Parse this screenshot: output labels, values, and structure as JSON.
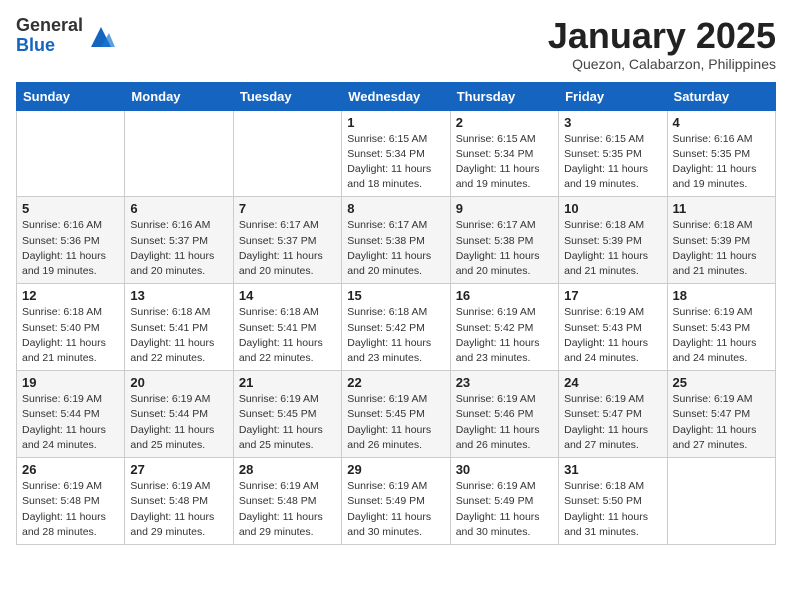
{
  "header": {
    "logo_general": "General",
    "logo_blue": "Blue",
    "month_title": "January 2025",
    "location": "Quezon, Calabarzon, Philippines"
  },
  "days_of_week": [
    "Sunday",
    "Monday",
    "Tuesday",
    "Wednesday",
    "Thursday",
    "Friday",
    "Saturday"
  ],
  "weeks": [
    [
      {
        "day": "",
        "sunrise": "",
        "sunset": "",
        "daylight": ""
      },
      {
        "day": "",
        "sunrise": "",
        "sunset": "",
        "daylight": ""
      },
      {
        "day": "",
        "sunrise": "",
        "sunset": "",
        "daylight": ""
      },
      {
        "day": "1",
        "sunrise": "Sunrise: 6:15 AM",
        "sunset": "Sunset: 5:34 PM",
        "daylight": "Daylight: 11 hours and 18 minutes."
      },
      {
        "day": "2",
        "sunrise": "Sunrise: 6:15 AM",
        "sunset": "Sunset: 5:34 PM",
        "daylight": "Daylight: 11 hours and 19 minutes."
      },
      {
        "day": "3",
        "sunrise": "Sunrise: 6:15 AM",
        "sunset": "Sunset: 5:35 PM",
        "daylight": "Daylight: 11 hours and 19 minutes."
      },
      {
        "day": "4",
        "sunrise": "Sunrise: 6:16 AM",
        "sunset": "Sunset: 5:35 PM",
        "daylight": "Daylight: 11 hours and 19 minutes."
      }
    ],
    [
      {
        "day": "5",
        "sunrise": "Sunrise: 6:16 AM",
        "sunset": "Sunset: 5:36 PM",
        "daylight": "Daylight: 11 hours and 19 minutes."
      },
      {
        "day": "6",
        "sunrise": "Sunrise: 6:16 AM",
        "sunset": "Sunset: 5:37 PM",
        "daylight": "Daylight: 11 hours and 20 minutes."
      },
      {
        "day": "7",
        "sunrise": "Sunrise: 6:17 AM",
        "sunset": "Sunset: 5:37 PM",
        "daylight": "Daylight: 11 hours and 20 minutes."
      },
      {
        "day": "8",
        "sunrise": "Sunrise: 6:17 AM",
        "sunset": "Sunset: 5:38 PM",
        "daylight": "Daylight: 11 hours and 20 minutes."
      },
      {
        "day": "9",
        "sunrise": "Sunrise: 6:17 AM",
        "sunset": "Sunset: 5:38 PM",
        "daylight": "Daylight: 11 hours and 20 minutes."
      },
      {
        "day": "10",
        "sunrise": "Sunrise: 6:18 AM",
        "sunset": "Sunset: 5:39 PM",
        "daylight": "Daylight: 11 hours and 21 minutes."
      },
      {
        "day": "11",
        "sunrise": "Sunrise: 6:18 AM",
        "sunset": "Sunset: 5:39 PM",
        "daylight": "Daylight: 11 hours and 21 minutes."
      }
    ],
    [
      {
        "day": "12",
        "sunrise": "Sunrise: 6:18 AM",
        "sunset": "Sunset: 5:40 PM",
        "daylight": "Daylight: 11 hours and 21 minutes."
      },
      {
        "day": "13",
        "sunrise": "Sunrise: 6:18 AM",
        "sunset": "Sunset: 5:41 PM",
        "daylight": "Daylight: 11 hours and 22 minutes."
      },
      {
        "day": "14",
        "sunrise": "Sunrise: 6:18 AM",
        "sunset": "Sunset: 5:41 PM",
        "daylight": "Daylight: 11 hours and 22 minutes."
      },
      {
        "day": "15",
        "sunrise": "Sunrise: 6:18 AM",
        "sunset": "Sunset: 5:42 PM",
        "daylight": "Daylight: 11 hours and 23 minutes."
      },
      {
        "day": "16",
        "sunrise": "Sunrise: 6:19 AM",
        "sunset": "Sunset: 5:42 PM",
        "daylight": "Daylight: 11 hours and 23 minutes."
      },
      {
        "day": "17",
        "sunrise": "Sunrise: 6:19 AM",
        "sunset": "Sunset: 5:43 PM",
        "daylight": "Daylight: 11 hours and 24 minutes."
      },
      {
        "day": "18",
        "sunrise": "Sunrise: 6:19 AM",
        "sunset": "Sunset: 5:43 PM",
        "daylight": "Daylight: 11 hours and 24 minutes."
      }
    ],
    [
      {
        "day": "19",
        "sunrise": "Sunrise: 6:19 AM",
        "sunset": "Sunset: 5:44 PM",
        "daylight": "Daylight: 11 hours and 24 minutes."
      },
      {
        "day": "20",
        "sunrise": "Sunrise: 6:19 AM",
        "sunset": "Sunset: 5:44 PM",
        "daylight": "Daylight: 11 hours and 25 minutes."
      },
      {
        "day": "21",
        "sunrise": "Sunrise: 6:19 AM",
        "sunset": "Sunset: 5:45 PM",
        "daylight": "Daylight: 11 hours and 25 minutes."
      },
      {
        "day": "22",
        "sunrise": "Sunrise: 6:19 AM",
        "sunset": "Sunset: 5:45 PM",
        "daylight": "Daylight: 11 hours and 26 minutes."
      },
      {
        "day": "23",
        "sunrise": "Sunrise: 6:19 AM",
        "sunset": "Sunset: 5:46 PM",
        "daylight": "Daylight: 11 hours and 26 minutes."
      },
      {
        "day": "24",
        "sunrise": "Sunrise: 6:19 AM",
        "sunset": "Sunset: 5:47 PM",
        "daylight": "Daylight: 11 hours and 27 minutes."
      },
      {
        "day": "25",
        "sunrise": "Sunrise: 6:19 AM",
        "sunset": "Sunset: 5:47 PM",
        "daylight": "Daylight: 11 hours and 27 minutes."
      }
    ],
    [
      {
        "day": "26",
        "sunrise": "Sunrise: 6:19 AM",
        "sunset": "Sunset: 5:48 PM",
        "daylight": "Daylight: 11 hours and 28 minutes."
      },
      {
        "day": "27",
        "sunrise": "Sunrise: 6:19 AM",
        "sunset": "Sunset: 5:48 PM",
        "daylight": "Daylight: 11 hours and 29 minutes."
      },
      {
        "day": "28",
        "sunrise": "Sunrise: 6:19 AM",
        "sunset": "Sunset: 5:48 PM",
        "daylight": "Daylight: 11 hours and 29 minutes."
      },
      {
        "day": "29",
        "sunrise": "Sunrise: 6:19 AM",
        "sunset": "Sunset: 5:49 PM",
        "daylight": "Daylight: 11 hours and 30 minutes."
      },
      {
        "day": "30",
        "sunrise": "Sunrise: 6:19 AM",
        "sunset": "Sunset: 5:49 PM",
        "daylight": "Daylight: 11 hours and 30 minutes."
      },
      {
        "day": "31",
        "sunrise": "Sunrise: 6:18 AM",
        "sunset": "Sunset: 5:50 PM",
        "daylight": "Daylight: 11 hours and 31 minutes."
      },
      {
        "day": "",
        "sunrise": "",
        "sunset": "",
        "daylight": ""
      }
    ]
  ]
}
